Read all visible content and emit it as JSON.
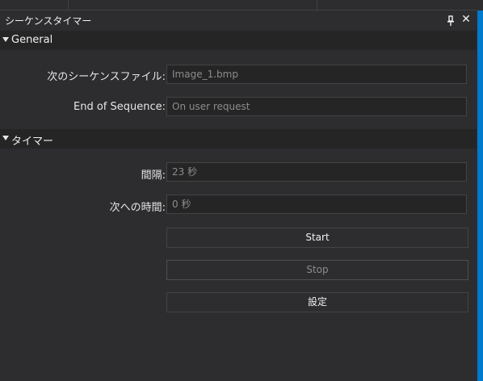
{
  "panel": {
    "title": "シーケンスタイマー",
    "pin_glyph": "🖈",
    "close_glyph": "✕",
    "icons": {
      "pin": "pin-icon",
      "close": "close-icon"
    }
  },
  "sections": {
    "general": {
      "label": "General",
      "next_file_label": "次のシーケンスファイル:",
      "next_file_value": "Image_1.bmp",
      "end_label": "End of Sequence:",
      "end_value": "On user request"
    },
    "timer": {
      "label": "タイマー",
      "interval_label": "間隔:",
      "interval_value": "23 秒",
      "time_to_next_label": "次への時間:",
      "time_to_next_value": "0 秒"
    }
  },
  "buttons": {
    "start": "Start",
    "stop": "Stop",
    "settings": "設定"
  },
  "colors": {
    "background": "#2d2d30",
    "section_header": "#252526",
    "accent": "#007acc",
    "disabled_text": "#8c8c8c"
  }
}
